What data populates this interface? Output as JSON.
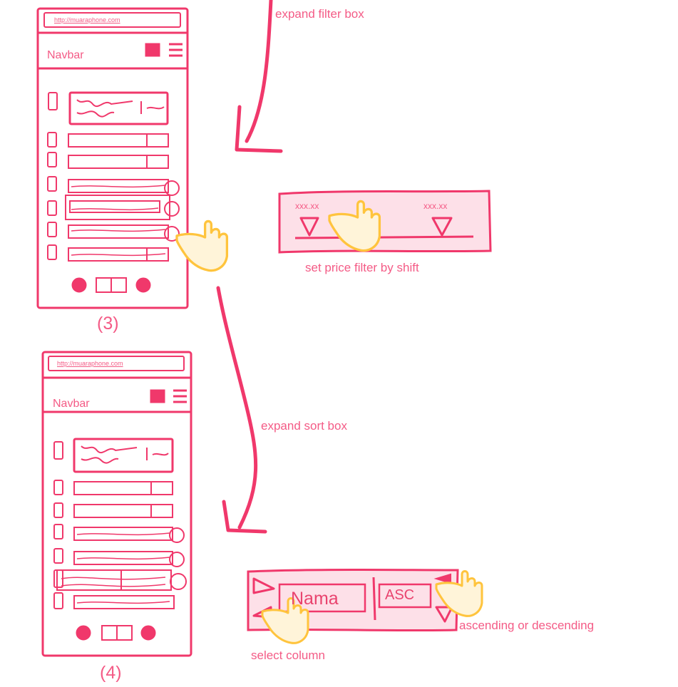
{
  "mockup_3": {
    "url": "http://muaraphone.com",
    "navbar": "Navbar",
    "caption": "(3)"
  },
  "mockup_4": {
    "url": "http://muaraphone.com",
    "navbar": "Navbar",
    "caption": "(4)"
  },
  "annotations": {
    "expand_filter": "expand filter  box",
    "price_filter": "set price filter by shift",
    "expand_sort": "expand sort  box",
    "ascending": "ascending or descending",
    "select_column": "select column"
  },
  "price_filter_box": {
    "min_label": "xxx.xx",
    "max_label": "xxx.xx"
  },
  "sort_box": {
    "column_value": "Nama",
    "order_value": "ASC"
  },
  "colors": {
    "stroke": "#f0386b",
    "fill": "#fde0e8",
    "hand": "#ffc43d",
    "text": "#f45b86"
  },
  "icons": [
    "hand-pointer-icon",
    "search-icon",
    "hamburger-menu-icon",
    "prev-page-icon",
    "next-page-icon",
    "arrow-icon"
  ]
}
